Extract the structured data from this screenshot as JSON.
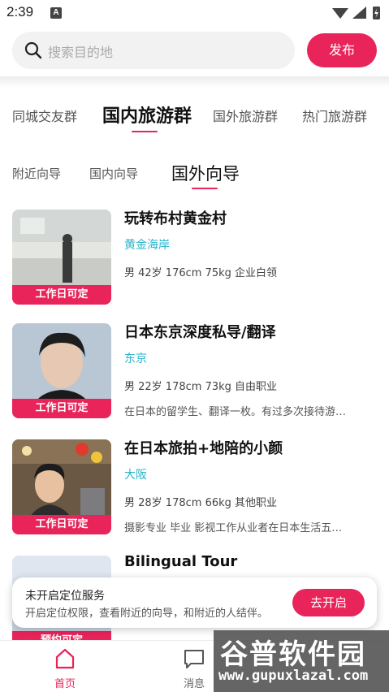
{
  "status_bar": {
    "time": "2:39",
    "notif_letter": "A"
  },
  "search": {
    "placeholder": "搜索目的地"
  },
  "header": {
    "publish_label": "发布"
  },
  "tabs": [
    {
      "label": "同城交友群"
    },
    {
      "label": "国内旅游群",
      "active": true
    },
    {
      "label": "国外旅游群"
    },
    {
      "label": "热门旅游群"
    }
  ],
  "subtabs": [
    {
      "label": "附近向导"
    },
    {
      "label": "国内向导"
    },
    {
      "label": "国外向导",
      "active": true
    }
  ],
  "guides": [
    {
      "title": "玩转布村黄金村",
      "location": "黄金海岸",
      "attrs": "男 42岁  176cm  75kg 企业白领",
      "desc": "",
      "badge": "工作日可定"
    },
    {
      "title": "日本东京深度私导/翻译",
      "location": "东京",
      "attrs": "男 22岁  178cm  73kg 自由职业",
      "desc": "在日本的留学生、翻译一枚。有过多次接待游…",
      "badge": "工作日可定"
    },
    {
      "title": "在日本旅拍+地陪的小颜",
      "location": "大阪",
      "attrs": "男 28岁  178cm  66kg 其他职业",
      "desc": "摄影专业 毕业 影视工作从业者在日本生活五…",
      "badge": "工作日可定"
    },
    {
      "title": "Bilingual Tour",
      "location": "",
      "attrs": "",
      "desc": "",
      "badge": "预约可定"
    }
  ],
  "toast": {
    "title": "未开启定位服务",
    "subtitle": "开启定位权限，查看附近的向导，和附近的人结伴。",
    "button_label": "去开启"
  },
  "bottom_nav": [
    {
      "label": "首页",
      "icon": "home-icon",
      "active": true
    },
    {
      "label": "消息",
      "icon": "message-icon"
    }
  ],
  "watermark": {
    "title": "谷普软件园",
    "url": "www.gupuxlazal.com"
  },
  "colors": {
    "accent": "#e8245a",
    "location": "#26b3c9"
  }
}
